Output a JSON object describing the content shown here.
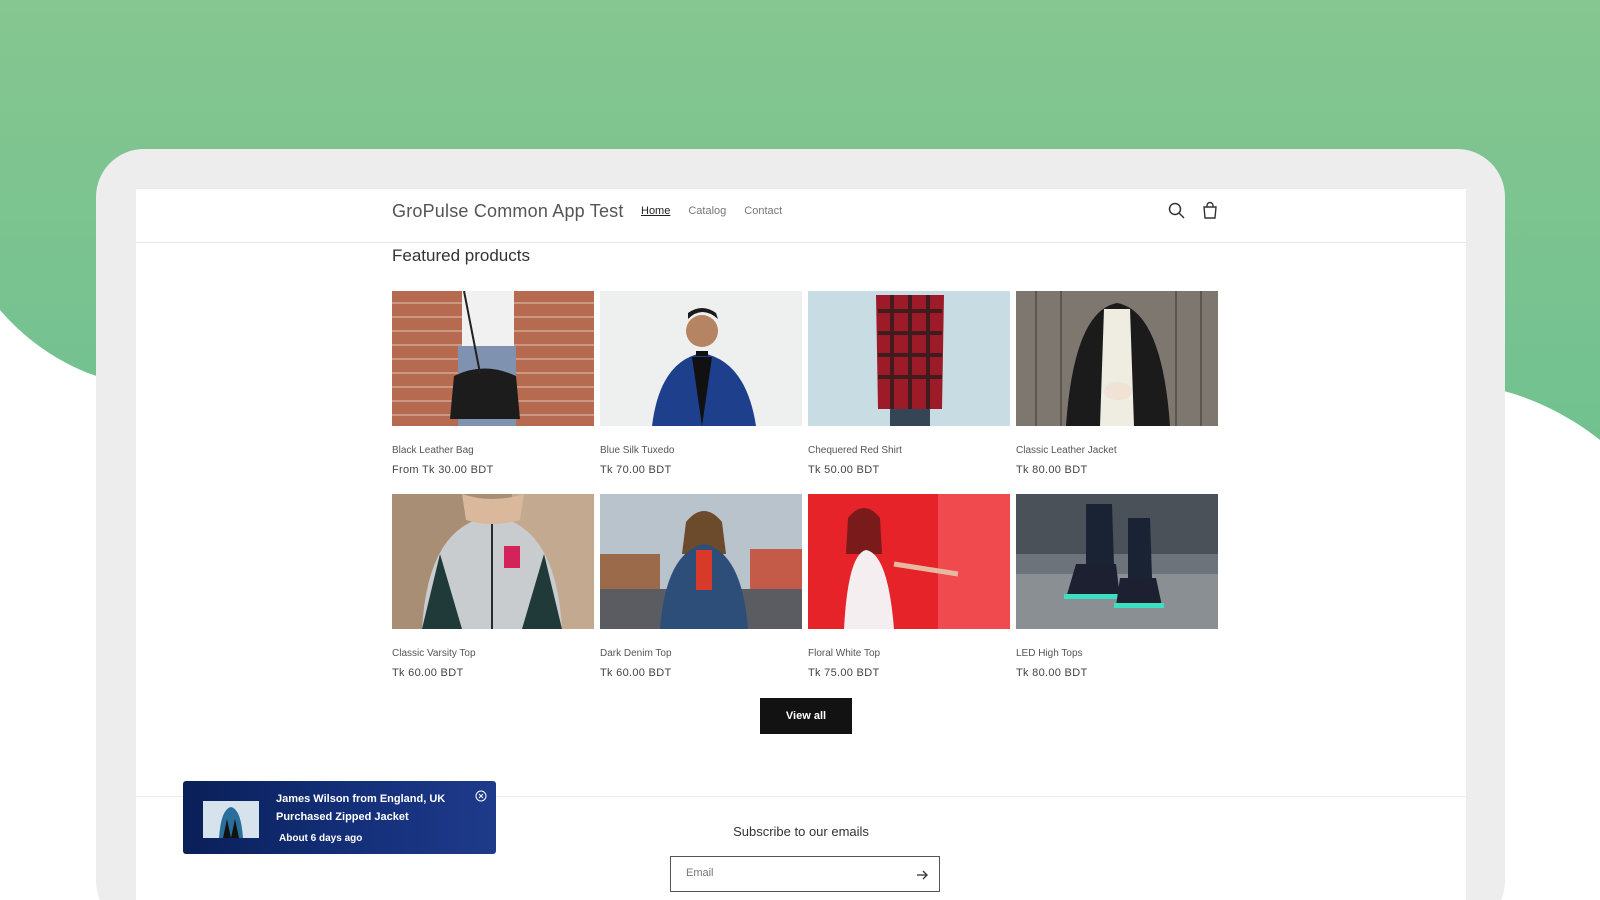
{
  "header": {
    "brand": "GroPulse Common App Test",
    "nav": [
      {
        "label": "Home",
        "active": true
      },
      {
        "label": "Catalog",
        "active": false
      },
      {
        "label": "Contact",
        "active": false
      }
    ],
    "icons": [
      "search-icon",
      "cart-icon"
    ]
  },
  "featured": {
    "title": "Featured products",
    "products": [
      {
        "name": "Black Leather Bag",
        "price": "From Tk 30.00 BDT"
      },
      {
        "name": "Blue Silk Tuxedo",
        "price": "Tk 70.00 BDT"
      },
      {
        "name": "Chequered Red Shirt",
        "price": "Tk 50.00 BDT"
      },
      {
        "name": "Classic Leather Jacket",
        "price": "Tk 80.00 BDT"
      },
      {
        "name": "Classic Varsity Top",
        "price": "Tk 60.00 BDT"
      },
      {
        "name": "Dark Denim Top",
        "price": "Tk 60.00 BDT"
      },
      {
        "name": "Floral White Top",
        "price": "Tk 75.00 BDT"
      },
      {
        "name": "LED High Tops",
        "price": "Tk 80.00 BDT"
      }
    ],
    "view_all_label": "View all"
  },
  "footer": {
    "subscribe_title": "Subscribe to our emails",
    "email_placeholder": "Email"
  },
  "toast": {
    "line1": "James Wilson from England, UK",
    "line2": "Purchased Zipped Jacket",
    "line3": "About 6 days ago"
  },
  "colors": {
    "background": "#7ec692",
    "button": "#121212",
    "toast_bg": "#14307a"
  }
}
